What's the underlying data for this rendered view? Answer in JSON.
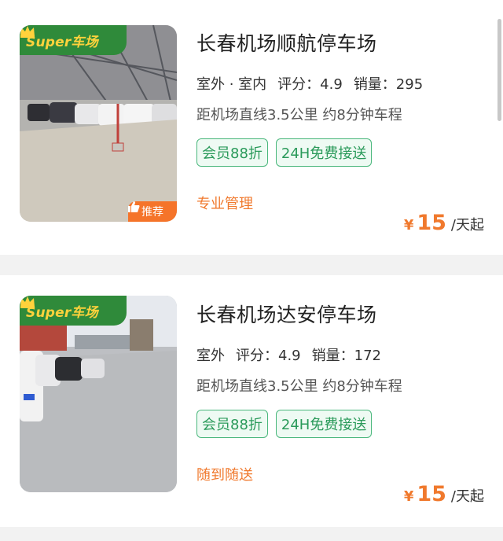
{
  "listings": [
    {
      "title": "长春机场顺航停车场",
      "badge": "Super车场",
      "recommend_label": "推荐",
      "location_type": "室外 · 室内",
      "rating": "评分：4.9",
      "sales": "销量：295",
      "distance": "距机场直线3.5公里 约8分钟车程",
      "tags": [
        "会员88折",
        "24H免费接送"
      ],
      "feature": "专业管理",
      "price_currency": "¥",
      "price_amount": "15",
      "price_unit": "/天起"
    },
    {
      "title": "长春机场达安停车场",
      "badge": "Super车场",
      "location_type": "室外",
      "rating": "评分：4.9",
      "sales": "销量：172",
      "distance": "距机场直线3.5公里 约8分钟车程",
      "tags": [
        "会员88折",
        "24H免费接送"
      ],
      "feature": "随到随送",
      "price_currency": "¥",
      "price_amount": "15",
      "price_unit": "/天起"
    }
  ],
  "colors": {
    "accent_orange": "#f0792d",
    "tag_green": "#4ab77c",
    "badge_green": "#2f8a3a",
    "badge_text": "#ffd23c"
  }
}
